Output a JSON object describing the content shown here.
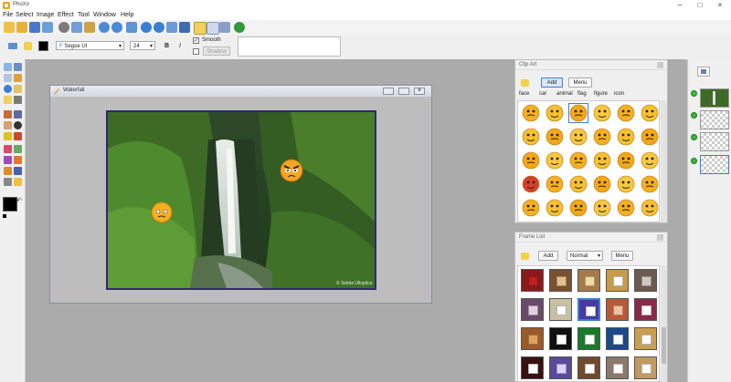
{
  "app": {
    "title": "PhoXo"
  },
  "menu": [
    "File",
    "Select",
    "Image",
    "Effect",
    "Tool",
    "Window",
    "Help"
  ],
  "text_props": {
    "font_name": "Segoe UI",
    "font_size": "24",
    "bold_label": "B",
    "italic_label": "I",
    "smooth_label": "Smooth",
    "smooth_checked": true,
    "shadow_label": "Shadow",
    "fill_color": "#000000"
  },
  "document": {
    "title": "Waterfall",
    "watermark": "© Selida Ulloplica"
  },
  "clipart": {
    "title": "Clip Art",
    "add_label": "Add",
    "menu_label": "Menu",
    "categories": [
      "face",
      "car",
      "animal",
      "flag",
      "figure",
      "icon"
    ],
    "selected_category": "face"
  },
  "framelist": {
    "title": "Frame List",
    "add_label": "Add",
    "mode": "Normal",
    "menu_label": "Menu"
  },
  "colors": {
    "accent": "#3a7fd5",
    "canvas_border": "#2e2a6e",
    "layer_dot": "#3bb83b"
  }
}
